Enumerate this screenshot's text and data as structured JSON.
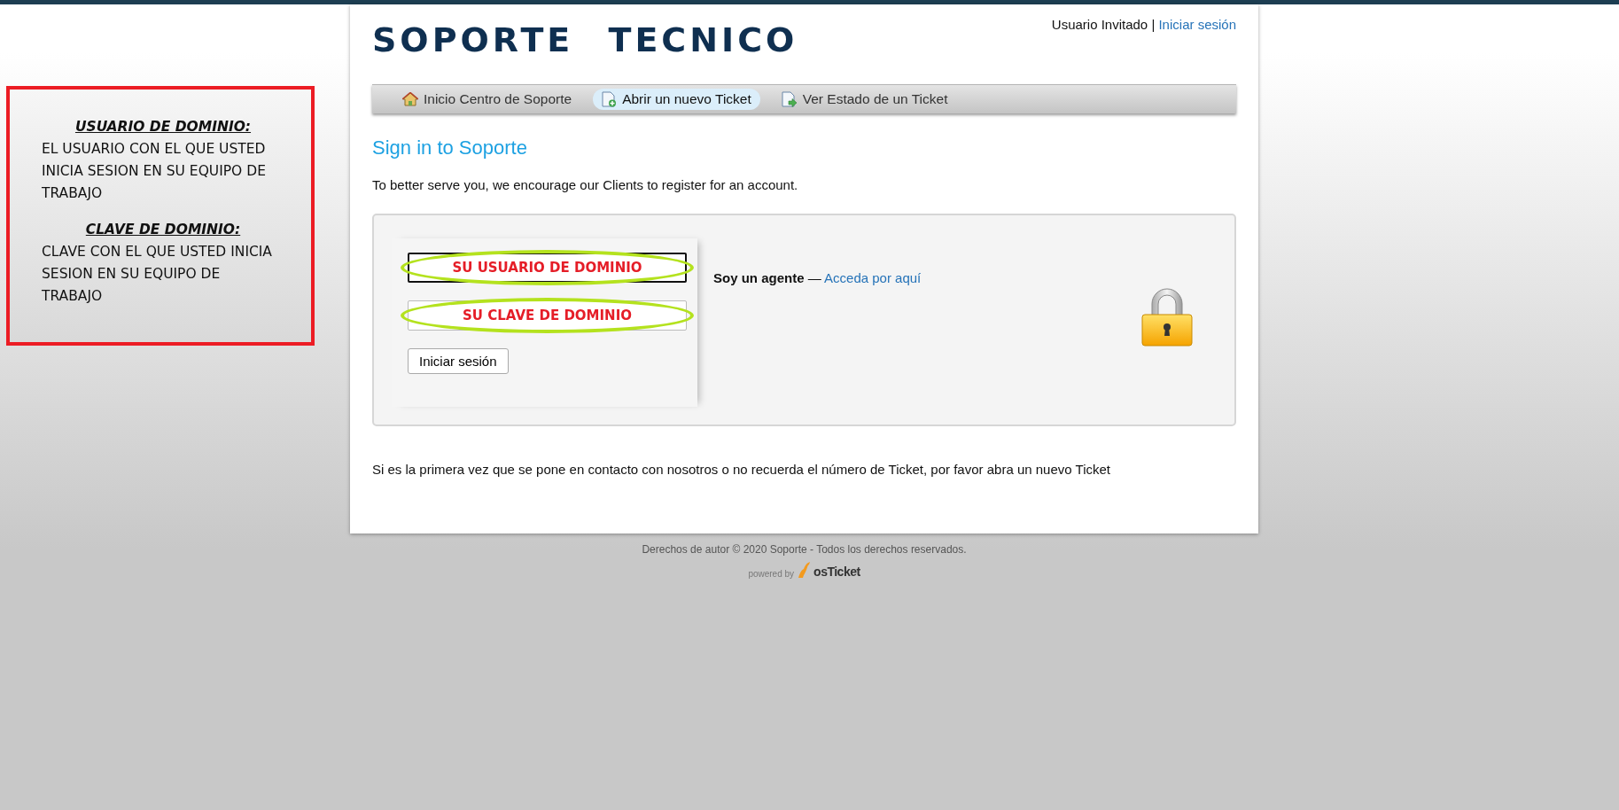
{
  "annotation": {
    "sections": [
      {
        "heading": "USUARIO DE DOMINIO:",
        "body": "EL USUARIO CON EL QUE USTED INICIA SESION EN SU EQUIPO DE TRABAJO"
      },
      {
        "heading": "CLAVE DE DOMINIO:",
        "body": "CLAVE CON EL QUE USTED INICIA SESION EN SU EQUIPO DE TRABAJO"
      }
    ]
  },
  "header": {
    "logo": "SOPORTE TECNICO",
    "user_label": "Usuario Invitado",
    "separator": "|",
    "sign_in_link": "Iniciar sesión"
  },
  "nav": [
    {
      "label": "Inicio Centro de Soporte",
      "kind": "home",
      "selected": false
    },
    {
      "label": "Abrir un nuevo Ticket",
      "kind": "new",
      "selected": true
    },
    {
      "label": "Ver Estado de un Ticket",
      "kind": "status",
      "selected": false
    }
  ],
  "heading": "Sign in to Soporte",
  "intro": "To better serve you, we encourage our Clients to register for an account.",
  "login": {
    "fields": [
      {
        "callout": "SU USUARIO DE DOMINIO",
        "focused": true
      },
      {
        "callout": "SU CLAVE DE DOMINIO",
        "focused": false
      }
    ],
    "button": "Iniciar sesión",
    "agent_label": "Soy un agente",
    "agent_dash": "—",
    "agent_link": "Acceda por aquí"
  },
  "notice": "Si es la primera vez que se pone en contacto con nosotros o no recuerda el número de Ticket, por favor abra un nuevo Ticket",
  "footer": {
    "copyright": "Derechos de autor © 2020 Soporte - Todos los derechos reservados.",
    "powered_by": "powered by",
    "brand": "osTicket"
  }
}
